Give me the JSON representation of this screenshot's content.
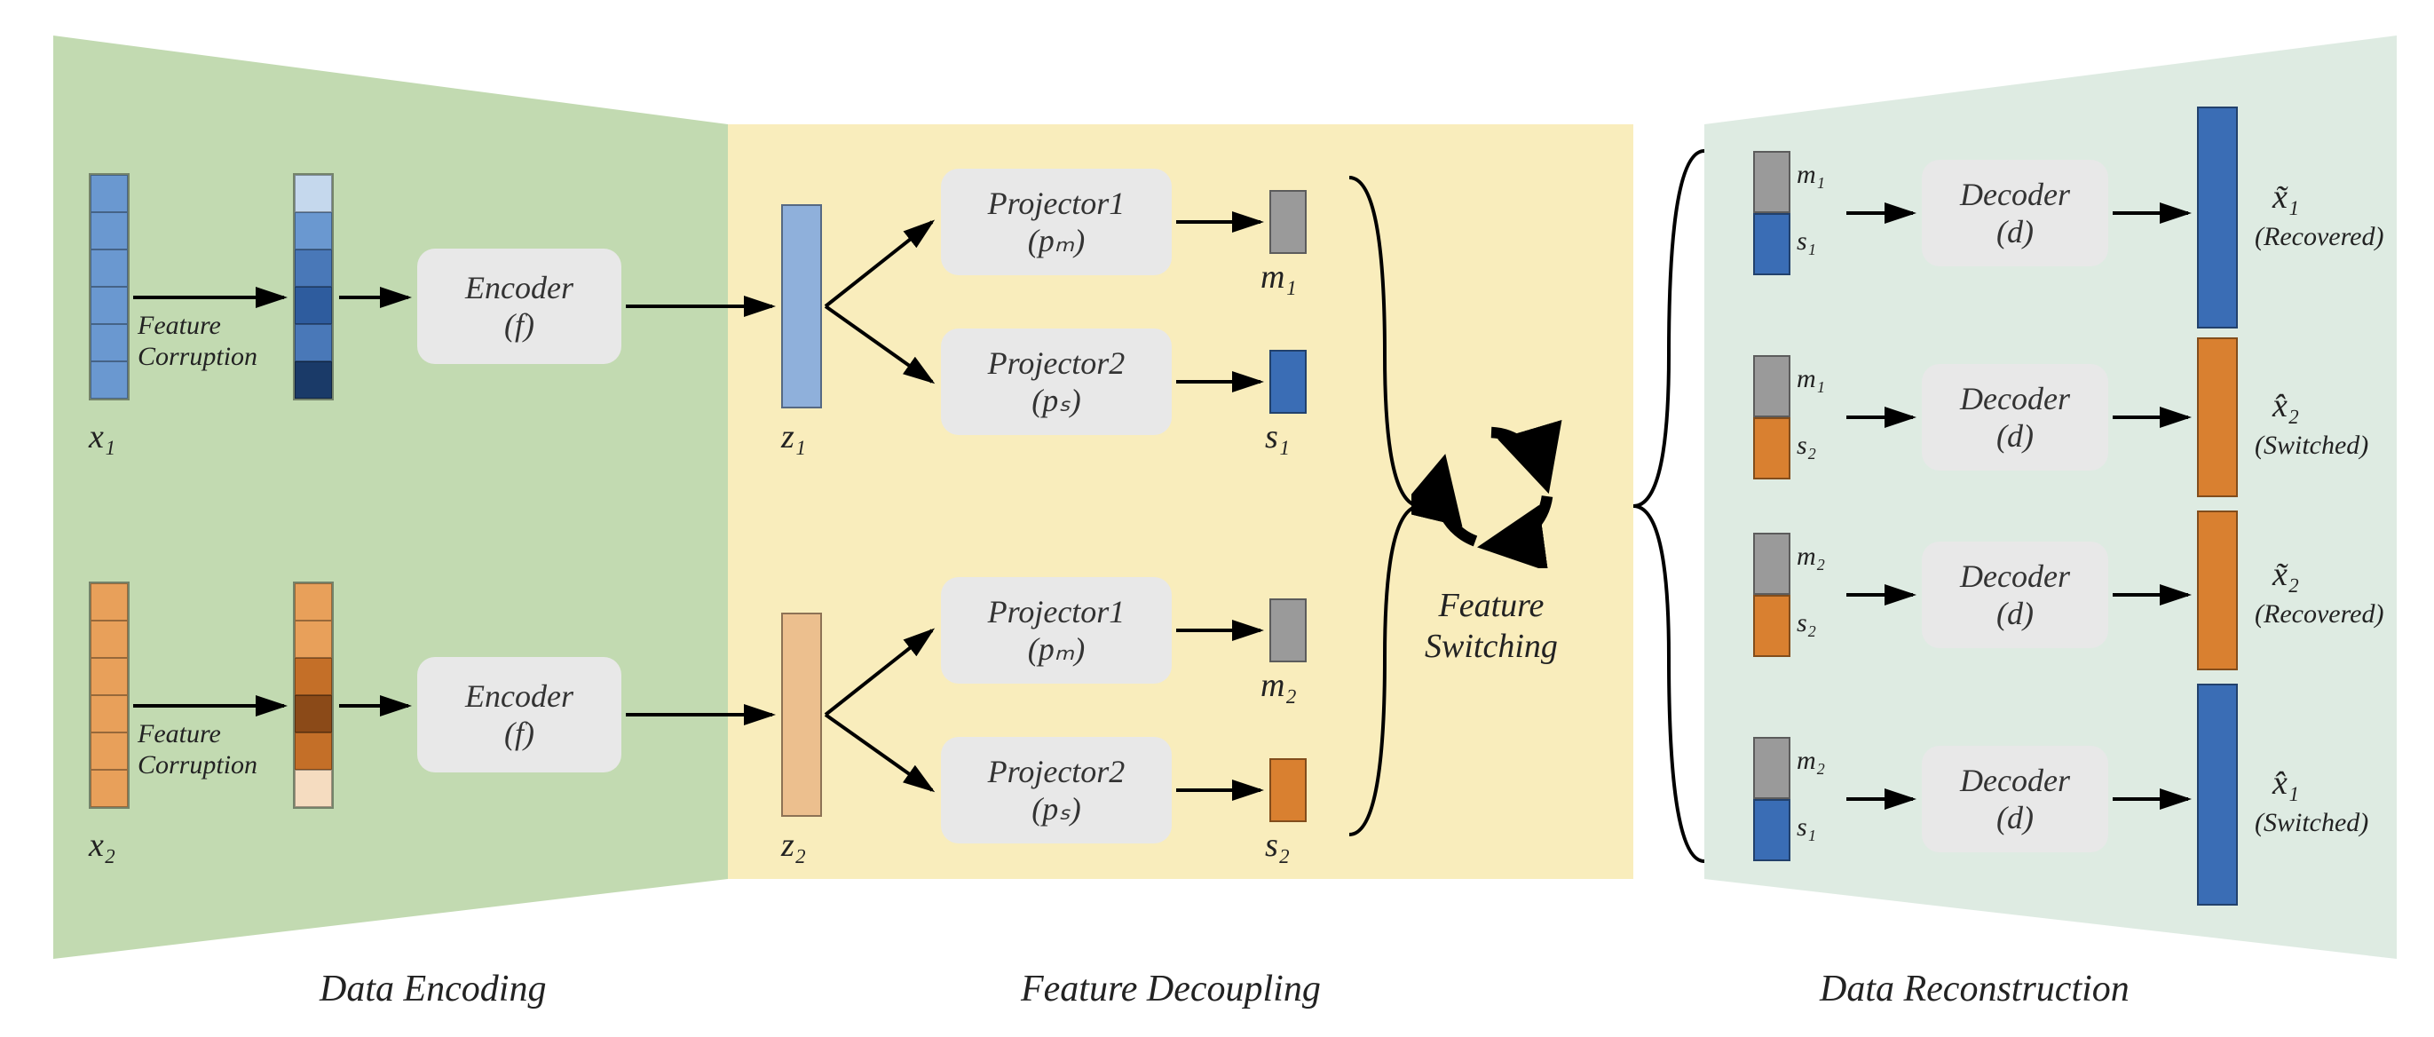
{
  "stages": {
    "encoding": "Data Encoding",
    "decoupling": "Feature Decoupling",
    "reconstruction": "Data Reconstruction"
  },
  "modules": {
    "encoder": {
      "title": "Encoder",
      "sub": "(f)"
    },
    "projector1": {
      "title": "Projector1",
      "sub": "(pₘ)"
    },
    "projector2": {
      "title": "Projector2",
      "sub": "(pₛ)"
    },
    "decoder": {
      "title": "Decoder",
      "sub": "(d)"
    }
  },
  "labels": {
    "feature_corruption": "Feature\nCorruption",
    "feature_switching": "Feature\nSwitching",
    "x1": "x₁",
    "x2": "x₂",
    "z1": "z₁",
    "z2": "z₂",
    "m1": "m₁",
    "m2": "m₂",
    "s1": "s₁",
    "s2": "s₂",
    "x1_tilde": "x̃₁",
    "x2_tilde": "x̃₂",
    "x1_hat": "x̂₁",
    "x2_hat": "x̂₂",
    "recovered": "(Recovered)",
    "switched": "(Switched)"
  },
  "colors": {
    "blue_main": "#6a98d0",
    "blue_dark": "#2e5c9e",
    "blue_darker": "#1a3a68",
    "blue_light": "#c5d8ed",
    "blue_mid": "#4978b8",
    "orange_main": "#e8a05a",
    "orange_dark": "#c46f28",
    "orange_darker": "#8b4a18",
    "orange_light": "#f5dcc0",
    "grey": "#9a9a9a",
    "s_blue": "#3a6db5",
    "s_orange": "#d98030",
    "out_blue": "#3a6db5",
    "out_orange": "#d98030"
  }
}
